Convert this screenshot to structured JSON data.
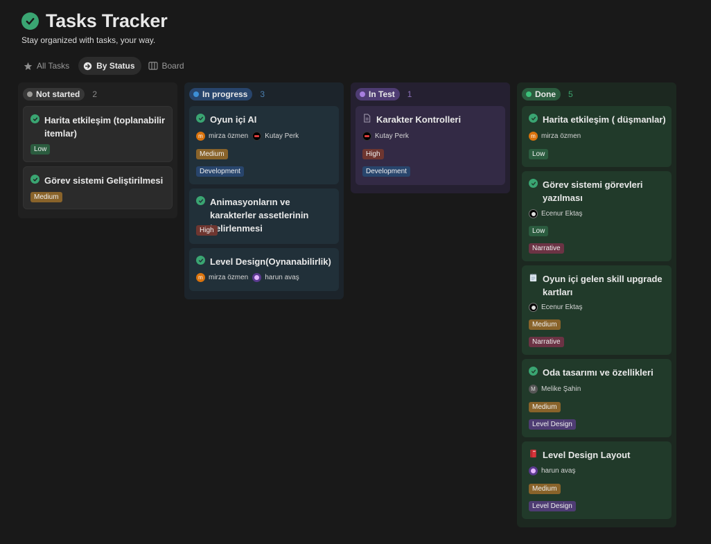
{
  "page": {
    "title": "Tasks Tracker",
    "subtitle": "Stay organized with tasks, your way."
  },
  "tabs": [
    {
      "label": "All Tasks",
      "icon": "star-icon",
      "active": false
    },
    {
      "label": "By Status",
      "icon": "arrow-circle-icon",
      "active": true
    },
    {
      "label": "Board",
      "icon": "board-icon",
      "active": false
    }
  ],
  "columns": [
    {
      "name": "Not started",
      "count": "2",
      "color": "#9b9a97",
      "cards": [
        {
          "title": "Harita etkileşim (toplanabilir itemlar)",
          "icon": "check-icon",
          "tags": [
            "Low"
          ]
        },
        {
          "title": "Görev sistemi Geliştirilmesi",
          "icon": "check-icon",
          "tags": [
            "Medium"
          ]
        }
      ]
    },
    {
      "name": "In progress",
      "count": "3",
      "color": "#2e7dbd",
      "cards": [
        {
          "title": "Oyun içi AI",
          "icon": "check-icon",
          "people": [
            "mirza özmen",
            "Kutay Perk"
          ],
          "tags": [
            "Medium",
            "Development"
          ]
        },
        {
          "title": "Animasyonların ve karakterler assetlerinin belirlenmesi",
          "icon": "check-icon",
          "tags": [
            "High"
          ]
        },
        {
          "title": "Level Design(Oynanabilirlik)",
          "icon": "check-icon",
          "people": [
            "mirza özmen",
            "harun avaş"
          ]
        }
      ]
    },
    {
      "name": "In Test",
      "count": "1",
      "color": "#9a6dd7",
      "cards": [
        {
          "title": "Karakter Kontrolleri",
          "icon": "document-icon",
          "people": [
            "Kutay Perk"
          ],
          "tags": [
            "High",
            "Development"
          ]
        }
      ]
    },
    {
      "name": "Done",
      "count": "5",
      "color": "#2ea26a",
      "cards": [
        {
          "title": "Harita etkileşim ( düşmanlar)",
          "icon": "check-icon",
          "people": [
            "mirza özmen"
          ],
          "tags": [
            "Low"
          ]
        },
        {
          "title": "Görev sistemi görevleri yazılması",
          "icon": "check-icon",
          "people": [
            "Ecenur Ektaş"
          ],
          "tags": [
            "Low",
            "Narrative"
          ]
        },
        {
          "title": "Oyun içi gelen skill upgrade kartları",
          "icon": "notepad-icon",
          "people": [
            "Ecenur Ektaş"
          ],
          "tags": [
            "Medium",
            "Narrative"
          ]
        },
        {
          "title": "Oda tasarımı ve özellikleri",
          "icon": "check-icon",
          "people": [
            "Melike Şahin"
          ],
          "tags": [
            "Medium",
            "Level Design"
          ]
        },
        {
          "title": "Level Design Layout",
          "icon": "book-icon",
          "people": [
            "harun avaş"
          ],
          "tags": [
            "Medium",
            "Level Design"
          ]
        }
      ]
    }
  ],
  "avatar_letters": {
    "mirza": "m",
    "melike": "M"
  },
  "colors": {
    "background": "#191919",
    "done_check": "#3aa572",
    "tag_low": "#2b5c3f",
    "tag_medium": "#89632a",
    "tag_high": "#6e3630",
    "tag_development": "#28456c",
    "tag_narrative": "#6b3344",
    "tag_level_design": "#4e3c73"
  }
}
